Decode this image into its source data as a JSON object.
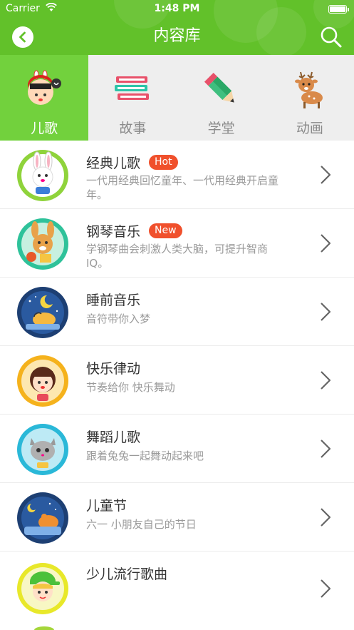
{
  "status_bar": {
    "carrier": "Carrier",
    "time": "1:48 PM"
  },
  "nav": {
    "title": "内容库"
  },
  "tabs": [
    {
      "label": "儿歌",
      "icon": "singing-girl-icon",
      "active": true
    },
    {
      "label": "故事",
      "icon": "books-icon",
      "active": false
    },
    {
      "label": "学堂",
      "icon": "pencil-icon",
      "active": false
    },
    {
      "label": "动画",
      "icon": "deer-icon",
      "active": false
    }
  ],
  "list": [
    {
      "title": "经典儿歌",
      "badge": "Hot",
      "desc": "一代用经典回忆童年、一代用经典开启童年。",
      "avatar": "bunny-avatar-icon"
    },
    {
      "title": "钢琴音乐",
      "badge": "New",
      "desc": "学钢琴曲会刺激人类大脑，可提升智商IQ。",
      "avatar": "rabbit-guitar-avatar-icon"
    },
    {
      "title": "睡前音乐",
      "badge": "",
      "desc": "音符带你入梦",
      "avatar": "moon-night-avatar-icon"
    },
    {
      "title": "快乐律动",
      "badge": "",
      "desc": "节奏给你 快乐舞动",
      "avatar": "girl-avatar-icon"
    },
    {
      "title": "舞蹈儿歌",
      "badge": "",
      "desc": "跟着兔兔一起舞动起来吧",
      "avatar": "cat-avatar-icon"
    },
    {
      "title": "儿童节",
      "badge": "",
      "desc": "六一 小朋友自己的节日",
      "avatar": "sleeping-bear-avatar-icon"
    },
    {
      "title": "少儿流行歌曲",
      "badge": "",
      "desc": "",
      "avatar": "boy-cap-avatar-icon"
    }
  ],
  "colors": {
    "header_green": "#62c12a",
    "active_tab_green": "#72d13d",
    "badge_red": "#f0502c"
  }
}
